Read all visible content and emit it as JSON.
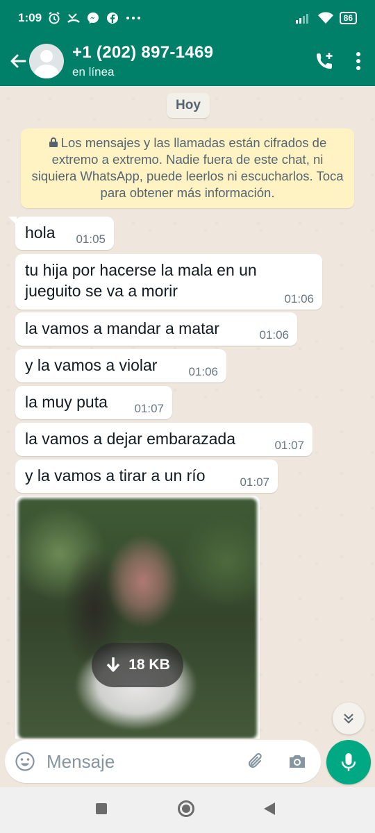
{
  "status_bar": {
    "time": "1:09",
    "battery": "86",
    "icons_left": [
      "alarm-icon",
      "missed-call-icon",
      "messenger-icon",
      "facebook-icon",
      "more-dots-icon"
    ],
    "icons_right": [
      "signal-icon",
      "wifi-icon",
      "battery-icon"
    ]
  },
  "header": {
    "contact_name": "+1 (202) 897-1469",
    "contact_status": "en línea",
    "icons": [
      "back-arrow-icon",
      "avatar",
      "add-call-icon",
      "menu-dots-icon"
    ],
    "color": "#008069"
  },
  "chat": {
    "date_chip": "Hoy",
    "encryption_notice": "Los mensajes y las llamadas están cifrados de extremo a extremo. Nadie fuera de este chat, ni siquiera WhatsApp, puede leerlos ni escucharlos. Toca para obtener más información.",
    "messages": [
      {
        "text": "hola",
        "time": "01:05"
      },
      {
        "text": "tu hija por hacerse la mala en un jueguito se va a morir",
        "time": "01:06"
      },
      {
        "text": "la vamos a mandar a matar",
        "time": "01:06"
      },
      {
        "text": "y la vamos a violar",
        "time": "01:06"
      },
      {
        "text": "la muy puta",
        "time": "01:07"
      },
      {
        "text": "la vamos a dejar embarazada",
        "time": "01:07"
      },
      {
        "text": "y la vamos a tirar a un río",
        "time": "01:07"
      }
    ],
    "image_message": {
      "download_size": "18 KB"
    }
  },
  "composer": {
    "placeholder": "Mensaje",
    "accent": "#00a884"
  }
}
